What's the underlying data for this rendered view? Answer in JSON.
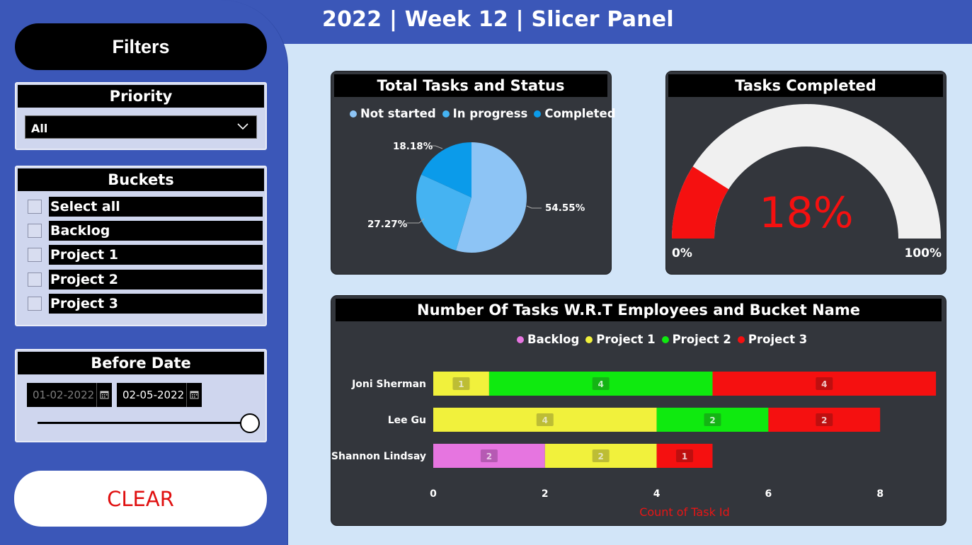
{
  "title": "2022 | Week 12 | Slicer Panel",
  "filters": {
    "heading": "Filters",
    "priority": {
      "heading": "Priority",
      "selected": "All"
    },
    "buckets": {
      "heading": "Buckets",
      "items": [
        "Select all",
        "Backlog",
        "Project 1",
        "Project 2",
        "Project 3"
      ]
    },
    "before_date": {
      "heading": "Before Date",
      "start": "01-02-2022",
      "end": "02-05-2022"
    },
    "clear_label": "CLEAR"
  },
  "colors": {
    "panel_blue": "#3b57b8",
    "background": "#d2e5f8",
    "not_started": "#8dc4f5",
    "in_progress": "#45b3f2",
    "completed": "#0b9bea",
    "backlog": "#e675e0",
    "project1": "#f1f13c",
    "project2": "#0fea0f",
    "project3": "#f51010",
    "gauge_fill": "#f51010",
    "gauge_track": "#f0f0f0"
  },
  "pie": {
    "title": "Total Tasks and Status",
    "legend": [
      "Not started",
      "In progress",
      "Completed"
    ],
    "labels": [
      "54.55%",
      "27.27%",
      "18.18%"
    ]
  },
  "gauge": {
    "title": "Tasks Completed",
    "value_label": "18%",
    "min_label": "0%",
    "max_label": "100%",
    "value": 0.18
  },
  "chart_data": [
    {
      "type": "pie",
      "title": "Total Tasks and Status",
      "categories": [
        "Not started",
        "In progress",
        "Completed"
      ],
      "values": [
        54.55,
        27.27,
        18.18
      ]
    },
    {
      "type": "bar",
      "orientation": "horizontal",
      "stacked": true,
      "title": "Number Of Tasks W.R.T Employees and Bucket Name",
      "categories": [
        "Joni Sherman",
        "Lee Gu",
        "Shannon Lindsay"
      ],
      "series": [
        {
          "name": "Backlog",
          "values": [
            0,
            0,
            2
          ]
        },
        {
          "name": "Project 1",
          "values": [
            1,
            4,
            2
          ]
        },
        {
          "name": "Project 2",
          "values": [
            4,
            2,
            0
          ]
        },
        {
          "name": "Project 3",
          "values": [
            4,
            2,
            1
          ]
        }
      ],
      "xlabel": "Count of Task Id",
      "xlim": [
        0,
        9
      ],
      "xticks": [
        "0",
        "2",
        "4",
        "6",
        "8"
      ],
      "legend_position": "top-center"
    }
  ]
}
